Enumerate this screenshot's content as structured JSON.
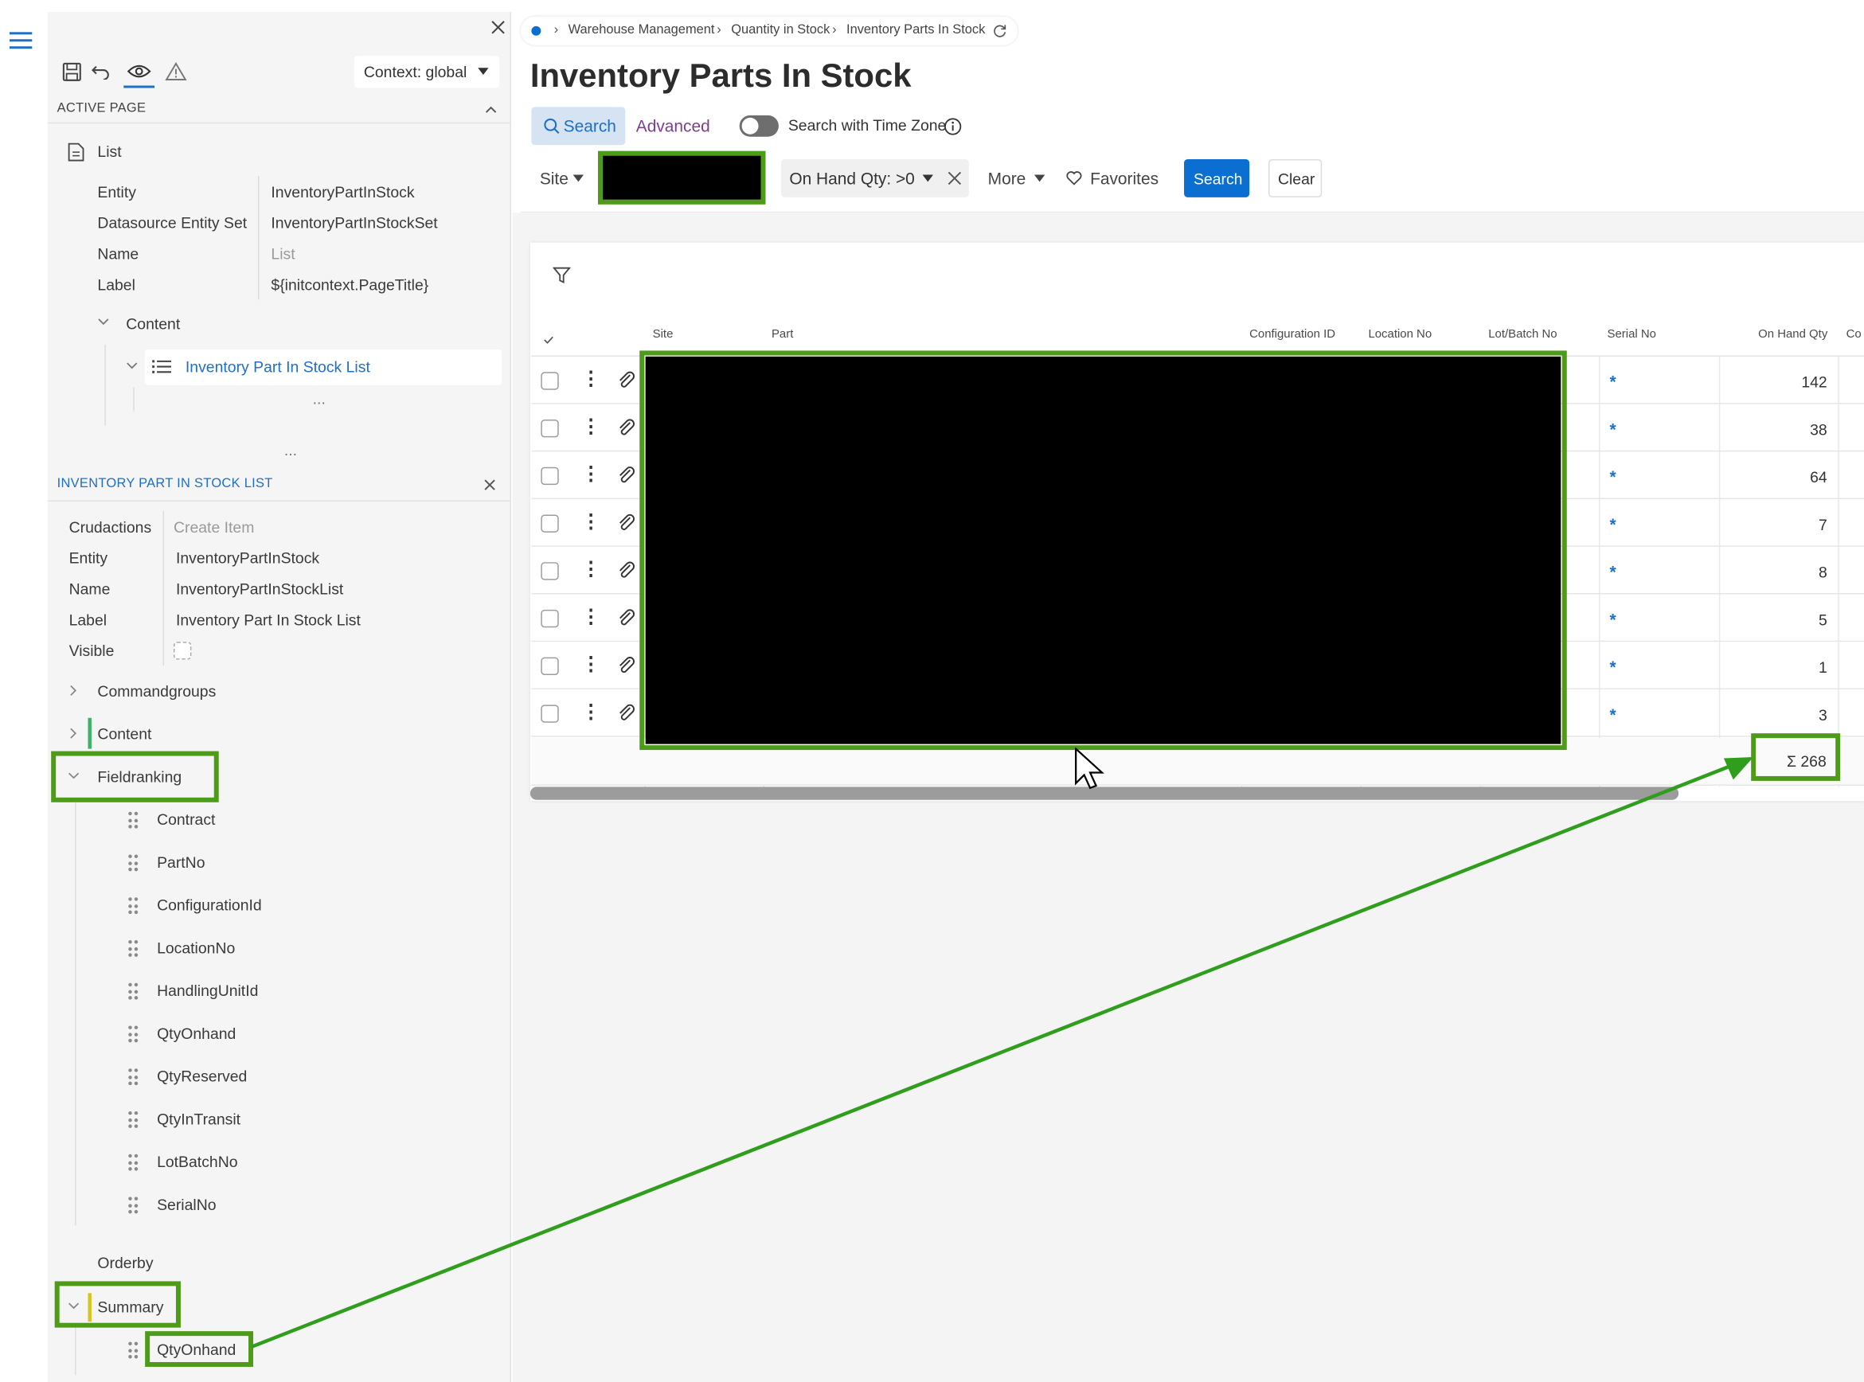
{
  "breadcrumb": {
    "items": [
      "Warehouse Management",
      "Quantity in Stock",
      "Inventory Parts In Stock"
    ]
  },
  "page": {
    "title": "Inventory Parts In Stock"
  },
  "search_bar": {
    "tab_search": "Search",
    "tab_advanced": "Advanced",
    "time_zone_label": "Search with Time Zone",
    "site_label": "Site",
    "filter_chip": "On Hand Qty: >0",
    "more_label": "More",
    "favorites_label": "Favorites",
    "search_button": "Search",
    "clear_button": "Clear"
  },
  "designer": {
    "context_label": "Context: global",
    "active_page_header": "ACTIVE PAGE",
    "page_type": "List",
    "properties": [
      {
        "label": "Entity",
        "value": "InventoryPartInStock"
      },
      {
        "label": "Datasource Entity Set",
        "value": "InventoryPartInStockSet"
      },
      {
        "label": "Name",
        "value": "List"
      },
      {
        "label": "Label",
        "value": "${initcontext.PageTitle}"
      }
    ],
    "content_label": "Content",
    "list_node": "Inventory Part In Stock List",
    "ellipsis": "...",
    "list_section_header": "INVENTORY PART IN STOCK LIST",
    "list_properties": [
      {
        "label": "Crudactions",
        "value": "Create Item"
      },
      {
        "label": "Entity",
        "value": "InventoryPartInStock"
      },
      {
        "label": "Name",
        "value": "InventoryPartInStockList"
      },
      {
        "label": "Label",
        "value": "Inventory Part In Stock List"
      },
      {
        "label": "Visible",
        "value": ""
      }
    ],
    "commandgroups_label": "Commandgroups",
    "content_node_label": "Content",
    "fieldranking_label": "Fieldranking",
    "fieldranking_items": [
      "Contract",
      "PartNo",
      "ConfigurationId",
      "LocationNo",
      "HandlingUnitId",
      "QtyOnhand",
      "QtyReserved",
      "QtyInTransit",
      "LotBatchNo",
      "SerialNo"
    ],
    "orderby_label": "Orderby",
    "summary_label": "Summary",
    "summary_item": "QtyOnhand"
  },
  "table": {
    "columns": [
      "Site",
      "Part",
      "Configuration ID",
      "Location No",
      "Lot/Batch No",
      "Serial No",
      "On Hand Qty",
      "Co"
    ],
    "rows": [
      {
        "serial": "*",
        "qty": "142"
      },
      {
        "serial": "*",
        "qty": "38"
      },
      {
        "serial": "*",
        "qty": "64"
      },
      {
        "serial": "*",
        "qty": "7"
      },
      {
        "serial": "*",
        "qty": "8"
      },
      {
        "serial": "*",
        "qty": "5"
      },
      {
        "serial": "*",
        "qty": "1"
      },
      {
        "serial": "*",
        "qty": "3"
      }
    ],
    "sum_label": "Σ 268"
  },
  "colors": {
    "accent": "#0b6fd1",
    "highlight": "#4d9b18",
    "advanced": "#7b3f8c",
    "redaction": "#000000"
  }
}
